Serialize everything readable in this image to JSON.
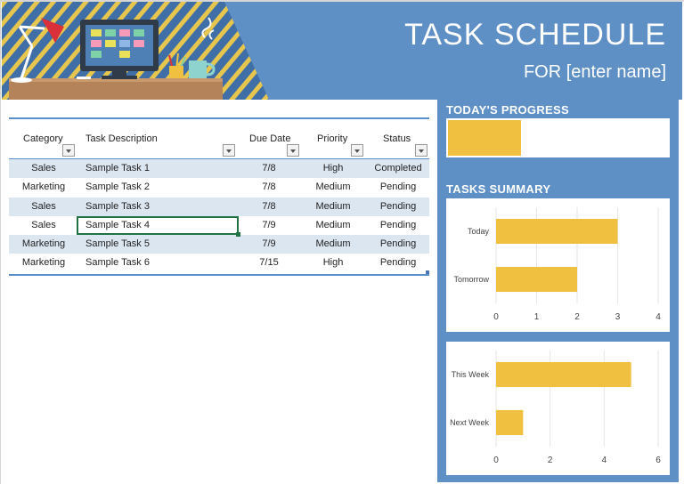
{
  "header": {
    "title": "TASK SCHEDULE",
    "subtitle": "FOR [enter name]"
  },
  "table": {
    "columns": [
      "Category",
      "Task Description",
      "Due Date",
      "Priority",
      "Status"
    ],
    "rows": [
      {
        "category": "Sales",
        "description": "Sample Task 1",
        "due": "7/8",
        "priority": "High",
        "status": "Completed"
      },
      {
        "category": "Marketing",
        "description": "Sample Task 2",
        "due": "7/8",
        "priority": "Medium",
        "status": "Pending"
      },
      {
        "category": "Sales",
        "description": "Sample Task 3",
        "due": "7/8",
        "priority": "Medium",
        "status": "Pending"
      },
      {
        "category": "Sales",
        "description": "Sample Task 4",
        "due": "7/9",
        "priority": "Medium",
        "status": "Pending"
      },
      {
        "category": "Marketing",
        "description": "Sample Task 5",
        "due": "7/9",
        "priority": "Medium",
        "status": "Pending"
      },
      {
        "category": "Marketing",
        "description": "Sample Task 6",
        "due": "7/15",
        "priority": "High",
        "status": "Pending"
      }
    ],
    "selected_row": 3
  },
  "dashboard": {
    "progress_heading": "TODAY'S PROGRESS",
    "progress_fraction": 0.33,
    "summary_heading": "TASKS SUMMARY"
  },
  "colors": {
    "banner": "#5f90c5",
    "bar": "#f0c140",
    "table_band": "#dce6f1",
    "table_rule": "#5b8fca",
    "selection": "#217346"
  },
  "icons": [
    "desk-lamp-icon",
    "monitor-icon",
    "pencil-cup-icon",
    "coffee-mug-icon",
    "filter-dropdown-icon"
  ],
  "chart_data": [
    {
      "type": "bar",
      "orientation": "horizontal",
      "categories": [
        "Today",
        "Tomorrow"
      ],
      "values": [
        3,
        2
      ],
      "xlim": [
        0,
        4
      ],
      "xticks": [
        0,
        1,
        2,
        3,
        4
      ],
      "grid": true
    },
    {
      "type": "bar",
      "orientation": "horizontal",
      "categories": [
        "This Week",
        "Next Week"
      ],
      "values": [
        5,
        1
      ],
      "xlim": [
        0,
        6
      ],
      "xticks": [
        0,
        2,
        4,
        6
      ],
      "grid": true
    }
  ]
}
